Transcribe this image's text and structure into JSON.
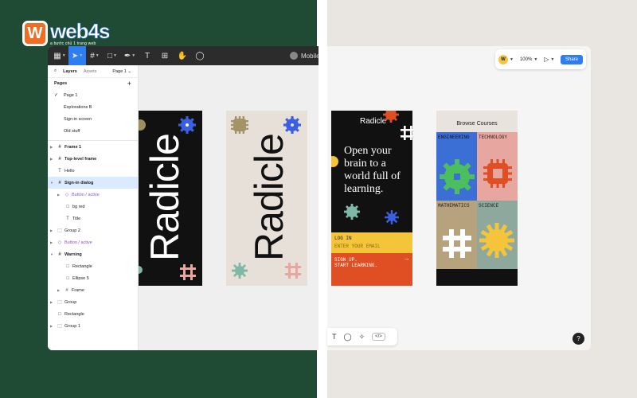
{
  "logo": {
    "badge": "W",
    "word": "web4s",
    "tagline": "a bước chủ 1 trang web"
  },
  "toolbar": {
    "tools": [
      "main-menu",
      "move",
      "frame",
      "shape",
      "pen",
      "text",
      "resources",
      "hand",
      "comment"
    ],
    "file_name": "Mobile"
  },
  "layers_panel": {
    "tabs": [
      "Layers",
      "Assets"
    ],
    "page_select": "Page 1",
    "pages_header": "Pages",
    "pages": [
      "Page 1",
      "Explorations B",
      "Sign-in screen",
      "Old stuff"
    ],
    "current_page": "Page 1",
    "layers": [
      {
        "label": "Frame 1",
        "kind": "frame",
        "bold": true
      },
      {
        "label": "Top-level frame",
        "kind": "frame",
        "bold": true
      },
      {
        "label": "Hello",
        "kind": "text"
      },
      {
        "label": "Sign-in dialog",
        "kind": "frame",
        "bold": true,
        "selected": true
      },
      {
        "label": "Button / active",
        "kind": "component"
      },
      {
        "label": "bg red",
        "kind": "rect"
      },
      {
        "label": "Title",
        "kind": "text"
      },
      {
        "label": "Group 2",
        "kind": "group"
      },
      {
        "label": "Button / active",
        "kind": "component"
      },
      {
        "label": "Warning",
        "kind": "frame",
        "bold": true
      },
      {
        "label": "Rectangle",
        "kind": "rect"
      },
      {
        "label": "Ellipse 5",
        "kind": "rect"
      },
      {
        "label": "Frame",
        "kind": "frame"
      },
      {
        "label": "Group",
        "kind": "group"
      },
      {
        "label": "Rectangle",
        "kind": "rect"
      },
      {
        "label": "Group 1",
        "kind": "group"
      }
    ]
  },
  "collab_bar": {
    "avatar": "W",
    "zoom": "100%",
    "share_label": "Share"
  },
  "bottom_toolbar": {
    "code_label": "</>"
  },
  "help_label": "?",
  "frames": {
    "frame1_word": "Radicle",
    "frame2_word": "Radicle",
    "frame3": {
      "logo": "Radicle",
      "headline": "Open your brain to a world full of learning.",
      "login_label": "LOG IN",
      "login_placeholder": "ENTER YOUR EMAIL",
      "signup_line1": "SIGN UP.",
      "signup_line2": "START LEARNING.",
      "arrow": "→"
    },
    "frame4": {
      "title": "Browse Courses",
      "cells": [
        "ENGINEERING",
        "TECHNOLOGY",
        "MATHEMATICS",
        "SCIENCE"
      ]
    }
  },
  "colors": {
    "green_bg": "#1f4a34",
    "accent_blue": "#2e7ef2",
    "radicle_yellow": "#f4c43a",
    "radicle_red": "#e04f23",
    "radicle_blue": "#3b5fe0",
    "radicle_green": "#4bbf5e"
  }
}
